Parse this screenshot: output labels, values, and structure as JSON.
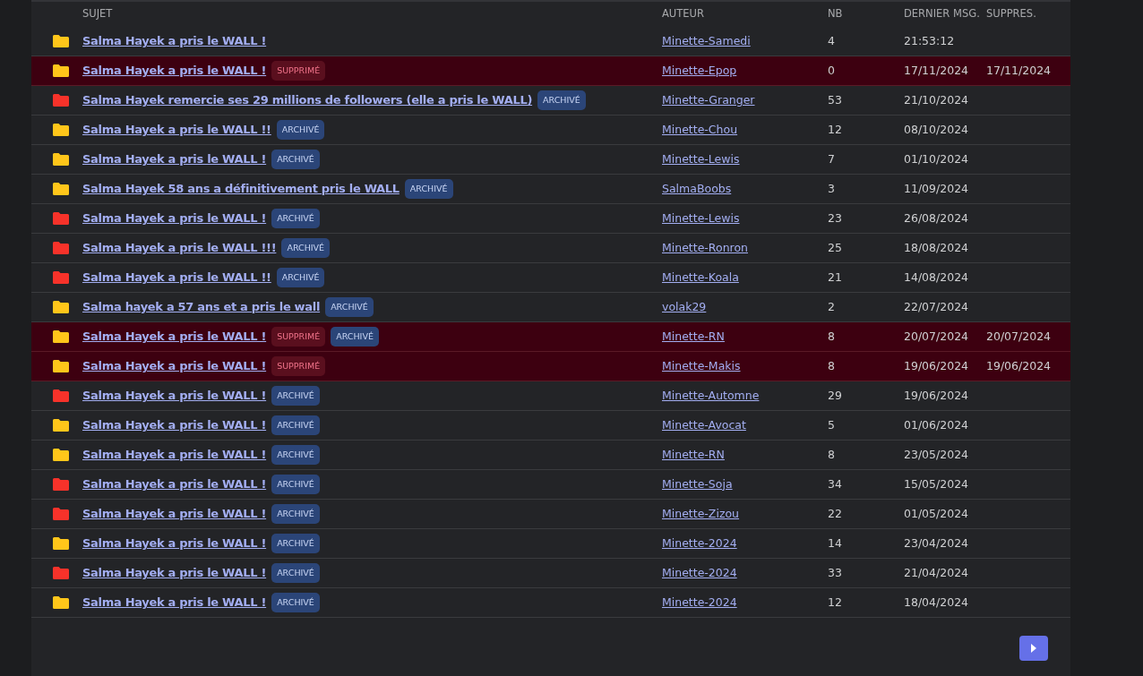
{
  "columns": [
    "SUJET",
    "AUTEUR",
    "NB",
    "DERNIER MSG.",
    "SUPPRES."
  ],
  "rows": [
    {
      "color": "#ffc61a",
      "deleted": false,
      "subject": "Salma Hayek a pris le WALL !",
      "badges": [],
      "author": "Minette-Samedi",
      "count": "4",
      "last": "21:53:12"
    },
    {
      "color": "#ffc61a",
      "deleted": true,
      "subject": "Salma Hayek a pris le WALL !",
      "badges": [
        {
          "kind": "deleted",
          "text": "SUPPRIMÉ"
        }
      ],
      "author": "Minette-Epop",
      "count": "0",
      "last": "17/11/2024",
      "removed": "17/11/2024"
    },
    {
      "color": "#f7322a",
      "deleted": false,
      "subject": "Salma Hayek remercie ses 29 millions de followers (elle a pris le WALL)",
      "badges": [
        {
          "kind": "archived",
          "text": "ARCHIVÉ"
        }
      ],
      "author": "Minette-Granger",
      "count": "53",
      "last": "21/10/2024"
    },
    {
      "color": "#ffc61a",
      "deleted": false,
      "subject": "Salma Hayek a pris le WALL !!",
      "badges": [
        {
          "kind": "archived",
          "text": "ARCHIVÉ"
        }
      ],
      "author": "Minette-Chou",
      "count": "12",
      "last": "08/10/2024"
    },
    {
      "color": "#ffc61a",
      "deleted": false,
      "subject": "Salma Hayek a pris le WALL !",
      "badges": [
        {
          "kind": "archived",
          "text": "ARCHIVÉ"
        }
      ],
      "author": "Minette-Lewis",
      "count": "7",
      "last": "01/10/2024"
    },
    {
      "color": "#ffc61a",
      "deleted": false,
      "subject": "Salma Hayek 58 ans a définitivement pris le WALL",
      "badges": [
        {
          "kind": "archived",
          "text": "ARCHIVÉ"
        }
      ],
      "author": "SalmaBoobs",
      "count": "3",
      "last": "11/09/2024"
    },
    {
      "color": "#f7322a",
      "deleted": false,
      "subject": "Salma Hayek a pris le WALL !",
      "badges": [
        {
          "kind": "archived",
          "text": "ARCHIVÉ"
        }
      ],
      "author": "Minette-Lewis",
      "count": "23",
      "last": "26/08/2024"
    },
    {
      "color": "#f7322a",
      "deleted": false,
      "subject": "Salma Hayek a pris le WALL !!!",
      "badges": [
        {
          "kind": "archived",
          "text": "ARCHIVÉ"
        }
      ],
      "author": "Minette-Ronron",
      "count": "25",
      "last": "18/08/2024"
    },
    {
      "color": "#f7322a",
      "deleted": false,
      "subject": "Salma Hayek a pris le WALL !!",
      "badges": [
        {
          "kind": "archived",
          "text": "ARCHIVÉ"
        }
      ],
      "author": "Minette-Koala",
      "count": "21",
      "last": "14/08/2024"
    },
    {
      "color": "#ffc61a",
      "deleted": false,
      "subject": "Salma hayek a 57 ans et a pris le wall",
      "badges": [
        {
          "kind": "archived",
          "text": "ARCHIVÉ"
        }
      ],
      "author": "volak29",
      "count": "2",
      "last": "22/07/2024"
    },
    {
      "color": "#ffc61a",
      "deleted": true,
      "subject": "Salma Hayek a pris le WALL !",
      "badges": [
        {
          "kind": "deleted",
          "text": "SUPPRIMÉ"
        },
        {
          "kind": "archived",
          "text": "ARCHIVÉ"
        }
      ],
      "author": "Minette-RN",
      "count": "8",
      "last": "20/07/2024",
      "removed": "20/07/2024"
    },
    {
      "color": "#ffc61a",
      "deleted": true,
      "subject": "Salma Hayek a pris le WALL !",
      "badges": [
        {
          "kind": "deleted",
          "text": "SUPPRIMÉ"
        }
      ],
      "author": "Minette-Makis",
      "count": "8",
      "last": "19/06/2024",
      "removed": "19/06/2024"
    },
    {
      "color": "#f7322a",
      "deleted": false,
      "subject": "Salma Hayek a pris le WALL !",
      "badges": [
        {
          "kind": "archived",
          "text": "ARCHIVÉ"
        }
      ],
      "author": "Minette-Automne",
      "count": "29",
      "last": "19/06/2024"
    },
    {
      "color": "#ffc61a",
      "deleted": false,
      "subject": "Salma Hayek a pris le WALL !",
      "badges": [
        {
          "kind": "archived",
          "text": "ARCHIVÉ"
        }
      ],
      "author": "Minette-Avocat",
      "count": "5",
      "last": "01/06/2024"
    },
    {
      "color": "#ffc61a",
      "deleted": false,
      "subject": "Salma Hayek a pris le WALL !",
      "badges": [
        {
          "kind": "archived",
          "text": "ARCHIVÉ"
        }
      ],
      "author": "Minette-RN",
      "count": "8",
      "last": "23/05/2024"
    },
    {
      "color": "#f7322a",
      "deleted": false,
      "subject": "Salma Hayek a pris le WALL !",
      "badges": [
        {
          "kind": "archived",
          "text": "ARCHIVÉ"
        }
      ],
      "author": "Minette-Soja",
      "count": "34",
      "last": "15/05/2024"
    },
    {
      "color": "#f7322a",
      "deleted": false,
      "subject": "Salma Hayek a pris le WALL !",
      "badges": [
        {
          "kind": "archived",
          "text": "ARCHIVÉ"
        }
      ],
      "author": "Minette-Zizou",
      "count": "22",
      "last": "01/05/2024"
    },
    {
      "color": "#ffc61a",
      "deleted": false,
      "subject": "Salma Hayek a pris le WALL !",
      "badges": [
        {
          "kind": "archived",
          "text": "ARCHIVÉ"
        }
      ],
      "author": "Minette-2024",
      "count": "14",
      "last": "23/04/2024"
    },
    {
      "color": "#f7322a",
      "deleted": false,
      "subject": "Salma Hayek a pris le WALL !",
      "badges": [
        {
          "kind": "archived",
          "text": "ARCHIVÉ"
        }
      ],
      "author": "Minette-2024",
      "count": "33",
      "last": "21/04/2024"
    },
    {
      "color": "#ffc61a",
      "deleted": false,
      "subject": "Salma Hayek a pris le WALL !",
      "badges": [
        {
          "kind": "archived",
          "text": "ARCHIVÉ"
        }
      ],
      "author": "Minette-2024",
      "count": "12",
      "last": "18/04/2024"
    }
  ]
}
